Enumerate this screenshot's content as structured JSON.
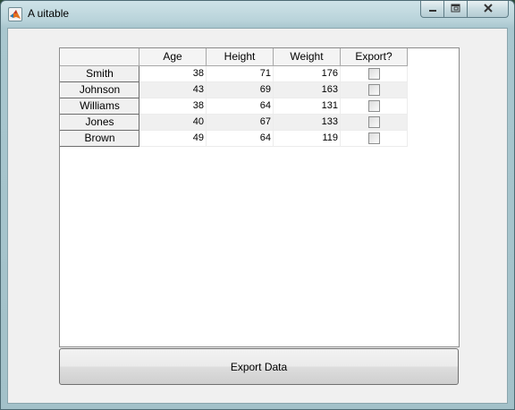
{
  "window": {
    "title": "A uitable",
    "icon": "matlab-icon"
  },
  "caption_buttons": {
    "minimize_icon": "minimize-icon",
    "maximize_icon": "maximize-icon",
    "close_icon": "close-icon"
  },
  "table": {
    "columns": [
      "Age",
      "Height",
      "Weight",
      "Export?"
    ],
    "rows": [
      {
        "name": "Smith",
        "age": "38",
        "height": "71",
        "weight": "176",
        "export": false
      },
      {
        "name": "Johnson",
        "age": "43",
        "height": "69",
        "weight": "163",
        "export": false
      },
      {
        "name": "Williams",
        "age": "38",
        "height": "64",
        "weight": "131",
        "export": false
      },
      {
        "name": "Jones",
        "age": "40",
        "height": "67",
        "weight": "133",
        "export": false
      },
      {
        "name": "Brown",
        "age": "49",
        "height": "64",
        "weight": "119",
        "export": false
      }
    ]
  },
  "export_button": {
    "label": "Export Data"
  },
  "colors": {
    "frame": "#a9c7cf",
    "client_background": "#f0f0f0",
    "alt_row": "#f0f0f0"
  }
}
